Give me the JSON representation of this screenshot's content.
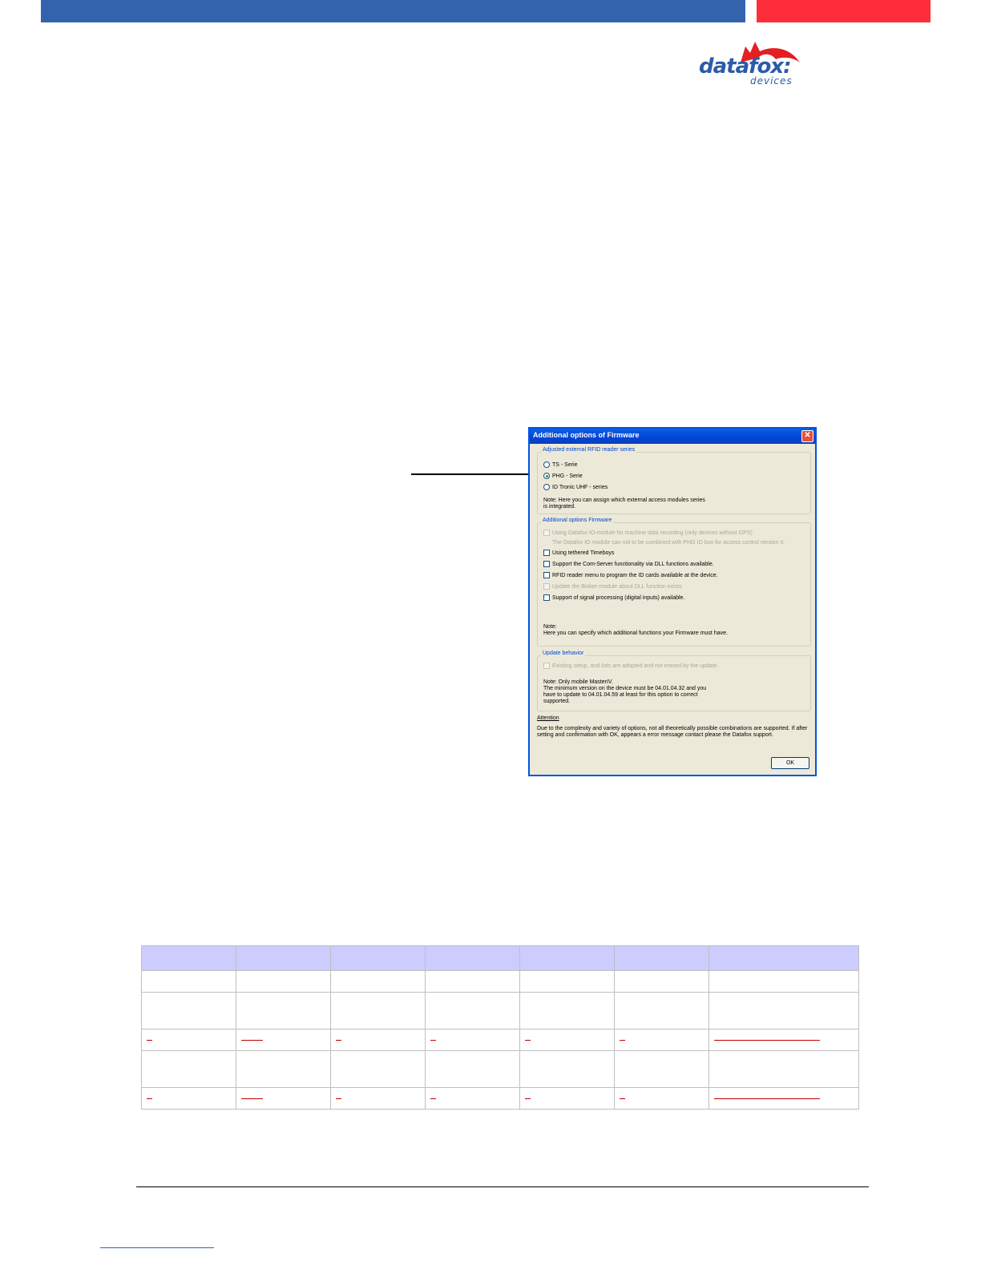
{
  "header": {
    "blue_bar_color": "#3463ae",
    "red_bar_color": "#fe2d3a"
  },
  "logo": {
    "name": "datafox",
    "colon": ":",
    "subtitle": "devices"
  },
  "dialog": {
    "title": "Additional options of Firmware",
    "group_reader": {
      "label": "Adjusted external RFID reader series",
      "options": [
        "TS - Serie",
        "PHG - Serie",
        "ID Tronic UHF - series"
      ],
      "selected": "PHG - Serie",
      "note": "Note: Here you can assign which external access modules series\n            is integrated."
    },
    "group_firmware": {
      "label": "Additional options Firmware",
      "items": [
        "Using Datafox IO-module for machine data recording (only devices without GPS)",
        "The Datafox IO module can not to be combined with PHG IO box for access control version II.",
        "Using tethered Timeboys",
        "Support the Com-Server functionality via DLL functions available.",
        "RFID reader menu to program the ID cards available at the device.",
        "Update the Bioker-module about DLL function exists.",
        "Support of signal processing (digital inputs) available."
      ],
      "note": "Note:\nHere you can specify which additional functions your Firmware must have."
    },
    "group_update": {
      "label": "Update behavior",
      "item": "Existing setup, and lists are adopted and not erased by the update.",
      "note": "Note: Only mobile MasterIV.\n          The minimum version on the device must be 04.01.04.32 and you\n          have to update to 04.01.04.59 at least for this option to correct\n          supported."
    },
    "attention_label": "Attention",
    "attention_text": "Due to the complexity and variety of options, not all theoretically possible combinations are supported. If after setting and confirmation with OK, appears a error message contact please the Datafox support.",
    "ok_label": "OK"
  }
}
